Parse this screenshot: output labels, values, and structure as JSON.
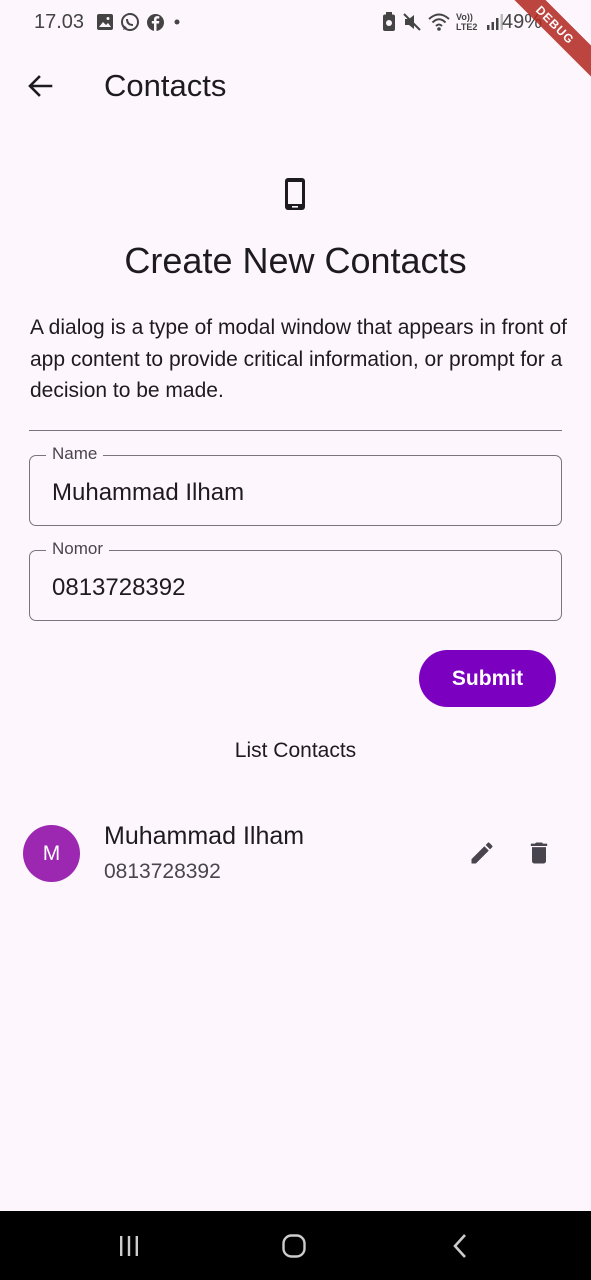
{
  "status_bar": {
    "time": "17.03",
    "battery": "49%",
    "left_icons": [
      "gallery-icon",
      "whatsapp-icon",
      "facebook-icon",
      "dot-icon"
    ],
    "right_icons": [
      "battery-saver-icon",
      "mute-icon",
      "wifi-icon",
      "volte-icon",
      "signal-icon"
    ],
    "network_label": "Vo)) LTE2",
    "debug_banner": "DEBUG"
  },
  "app_bar": {
    "title": "Contacts",
    "back_icon": "arrow-back-icon"
  },
  "dialog": {
    "icon": "smartphone-icon",
    "title": "Create New Contacts",
    "description": "A dialog is a type of modal window that appears in front of app content to provide critical information, or prompt for a decision to be made."
  },
  "form": {
    "name_label": "Name",
    "name_value": "Muhammad Ilham",
    "nomor_label": "Nomor",
    "nomor_value": "0813728392",
    "submit_label": "Submit"
  },
  "list": {
    "title": "List Contacts",
    "items": [
      {
        "initial": "M",
        "name": "Muhammad Ilham",
        "phone": "0813728392",
        "edit_icon": "edit-icon",
        "delete_icon": "delete-icon"
      }
    ]
  },
  "nav_bar": {
    "icons": [
      "recents-icon",
      "home-icon",
      "back-icon"
    ]
  },
  "colors": {
    "background": "#fdf7fd",
    "accent": "#7b00bf",
    "avatar": "#9c27b0",
    "outline": "#79747e"
  }
}
